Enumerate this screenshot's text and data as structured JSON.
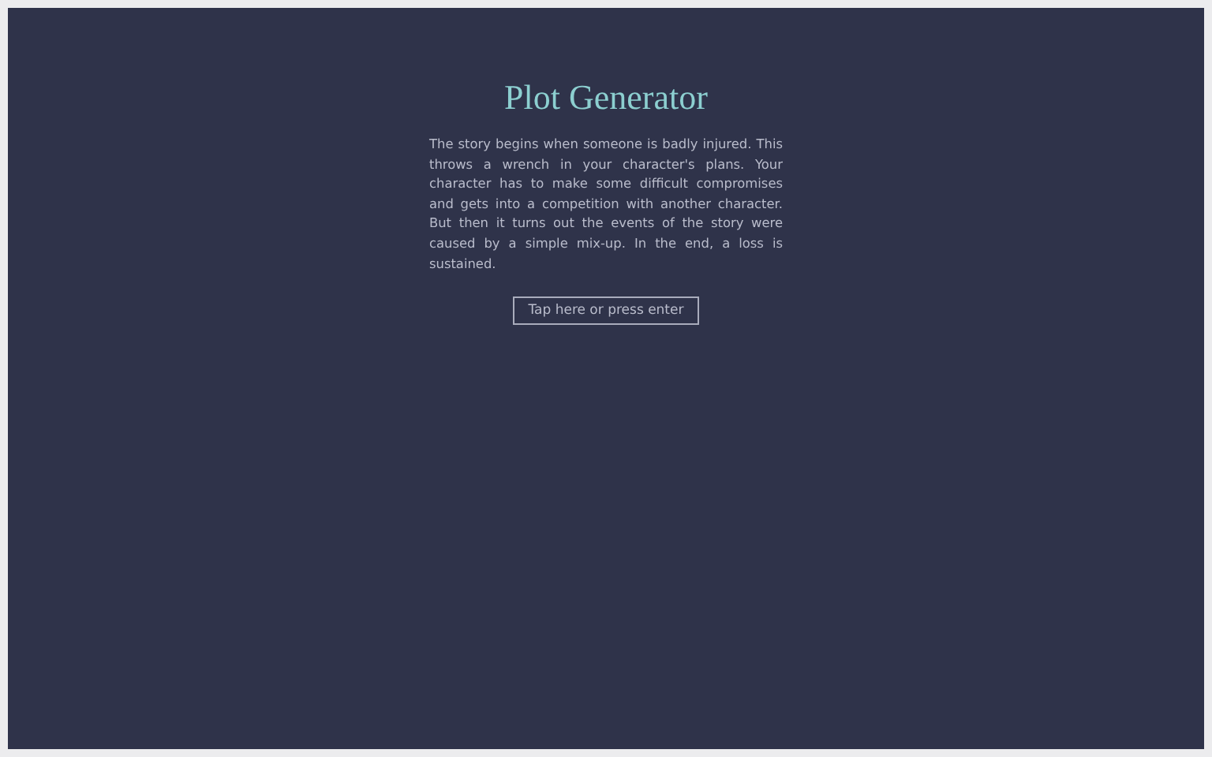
{
  "title": "Plot Generator",
  "plot": "The story begins when someone is badly injured. This throws a wrench in your character's plans. Your character has to make some difficult compromises and gets into a competition with another character. But then it turns out the events of the story were caused by a simple mix-up. In the end, a loss is sustained.",
  "button": "Tap here or press enter"
}
